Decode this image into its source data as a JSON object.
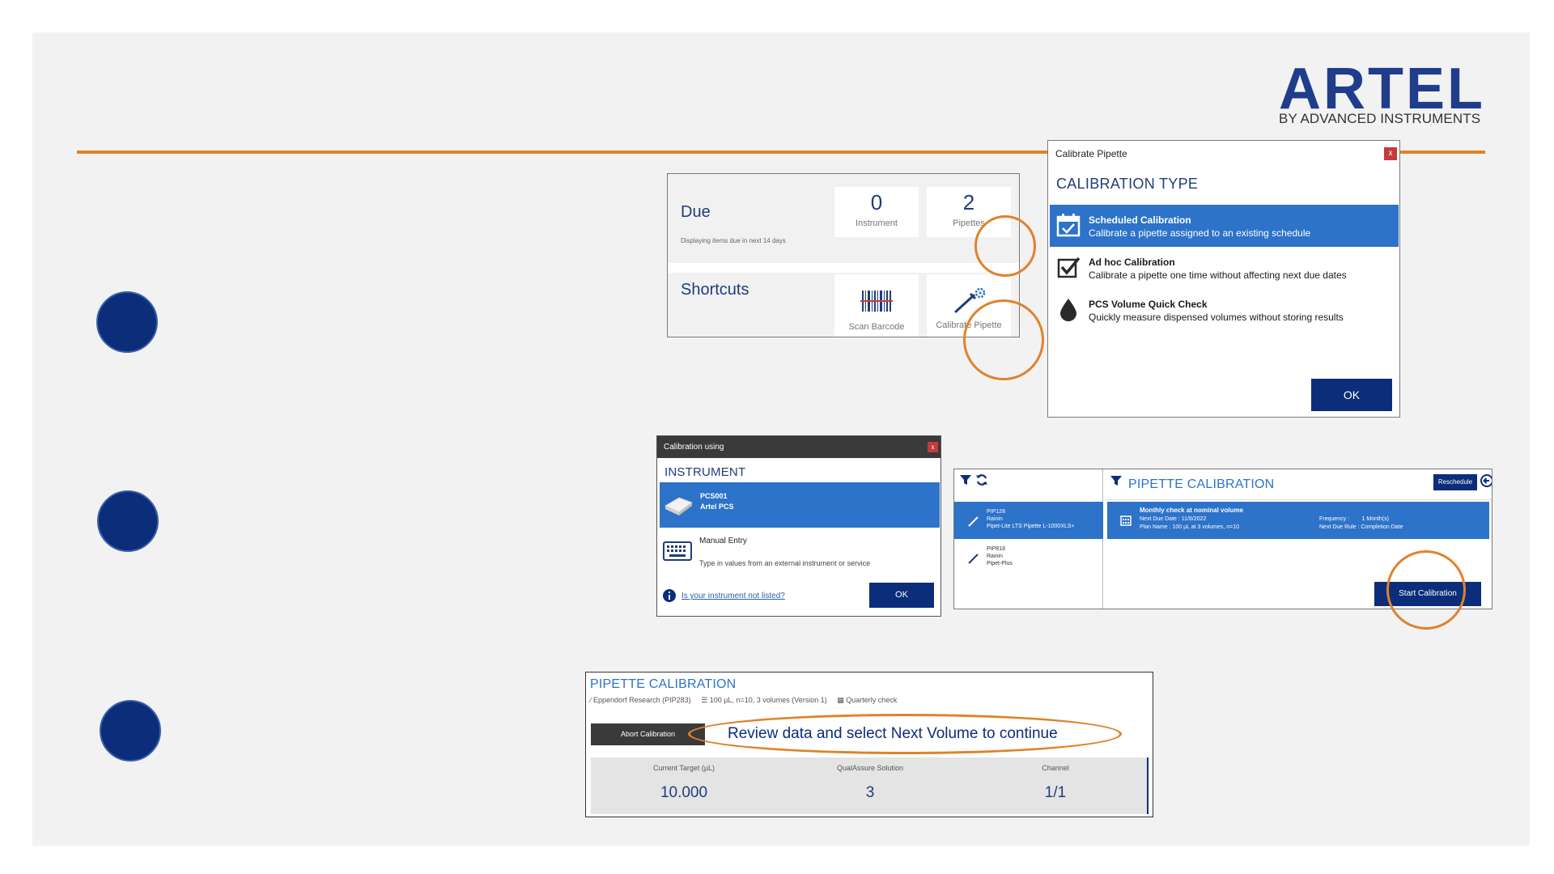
{
  "logo": {
    "text": "ARTEL",
    "subtitle": "BY ADVANCED INSTRUMENTS",
    "color": "#1f3d8a"
  },
  "colors": {
    "accent": "#e0822b",
    "navy": "#0b2d7a",
    "highlight": "#2c73c9"
  },
  "due_panel": {
    "due_label": "Due",
    "due_note": "Displaying items due in next 14 days",
    "instrument_count": "0",
    "instrument_label": "Instrument",
    "pipettes_count": "2",
    "pipettes_label": "Pipettes",
    "shortcuts_label": "Shortcuts",
    "scan_label": "Scan Barcode",
    "calibrate_label": "Calibrate Pipette"
  },
  "calibration_type_dialog": {
    "title": "Calibrate Pipette",
    "close": "x",
    "heading": "CALIBRATION TYPE",
    "options": [
      {
        "title": "Scheduled Calibration",
        "desc": "Calibrate a pipette assigned to an existing schedule",
        "icon": "calendar-check-icon"
      },
      {
        "title": "Ad hoc Calibration",
        "desc": "Calibrate a pipette one time without affecting next due dates",
        "icon": "checkbox-icon"
      },
      {
        "title": "PCS Volume Quick Check",
        "desc": "Quickly measure dispensed volumes without storing results",
        "icon": "drop-icon"
      }
    ],
    "ok": "OK"
  },
  "instrument_dialog": {
    "title": "Calibration using",
    "close": "x",
    "heading": "INSTRUMENT",
    "selected_line1": "PCS001",
    "selected_line2": "Artel PCS",
    "manual_title": "Manual Entry",
    "manual_desc": "Type in values from an external instrument or service",
    "link": "Is your instrument not listed?",
    "ok": "OK"
  },
  "pipette_list": {
    "title": "PIPETTE CALIBRATION",
    "reschedule": "Reschedule",
    "items": [
      {
        "id": "PIP128",
        "brand": "Rainin",
        "model": "Pipet-Lite LTS Pipette L-1000XLS+"
      },
      {
        "id": "PIP818",
        "brand": "Rainin",
        "model": "Pipet-Plus"
      }
    ],
    "schedule": {
      "name": "Monthly check at nominal volume",
      "next_due": "Next Due Date :  11/6/2022",
      "plan": "Plan Name :  100 µL at 3 volumes, n=10",
      "frequency": "Frequency :        1 Month(s)",
      "rule": "Next Due Rule :  Completion Date"
    },
    "start": "Start Calibration"
  },
  "run_panel": {
    "title": "PIPETTE CALIBRATION",
    "pipette": "Eppendorf Research (PIP283)",
    "plan": "100 µL, n=10, 3 volumes (Version 1)",
    "schedule": "Quarterly check",
    "abort": "Abort Calibration",
    "message": "Review data and select Next Volume to continue",
    "fields": [
      {
        "label": "Current Target (µL)",
        "value": "10.000"
      },
      {
        "label": "QualAssure Solution",
        "value": "3"
      },
      {
        "label": "Channel",
        "value": "1/1"
      }
    ]
  }
}
